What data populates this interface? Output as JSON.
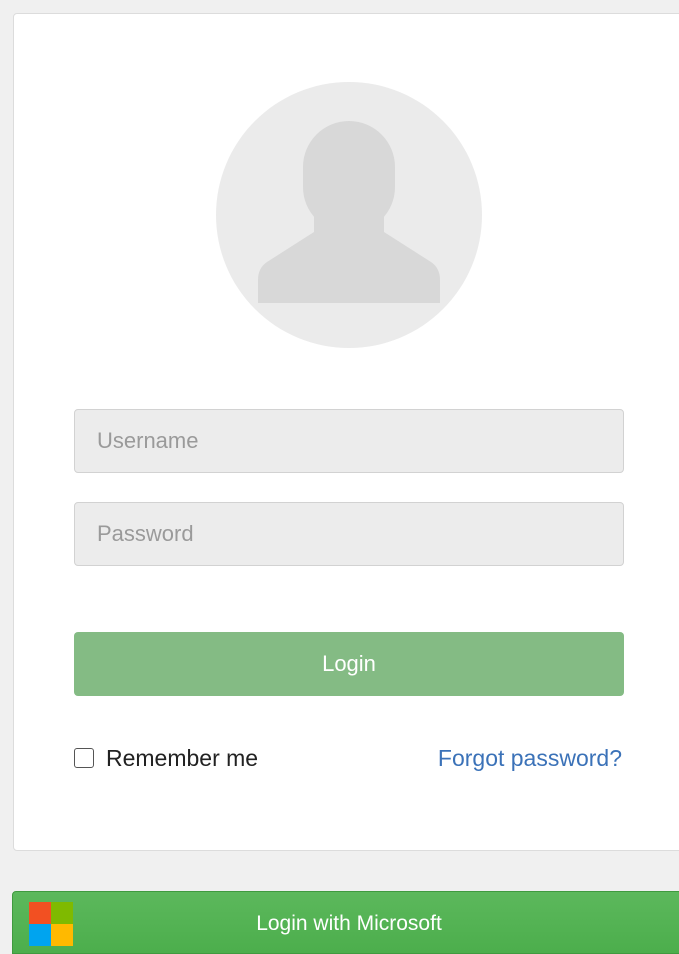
{
  "login_form": {
    "username_placeholder": "Username",
    "password_placeholder": "Password",
    "login_label": "Login",
    "remember_label": "Remember me",
    "remember_checked": false,
    "forgot_label": "Forgot password?"
  },
  "microsoft_login": {
    "label": "Login with Microsoft",
    "logo_colors": [
      "#f25022",
      "#7fba00",
      "#00a4ef",
      "#ffb900"
    ]
  },
  "icons": {
    "avatar": "user-silhouette-icon",
    "microsoft": "microsoft-logo-icon"
  },
  "colors": {
    "login_button": "#84bb84",
    "microsoft_button": "#5cb85c",
    "link": "#3b72b8"
  }
}
